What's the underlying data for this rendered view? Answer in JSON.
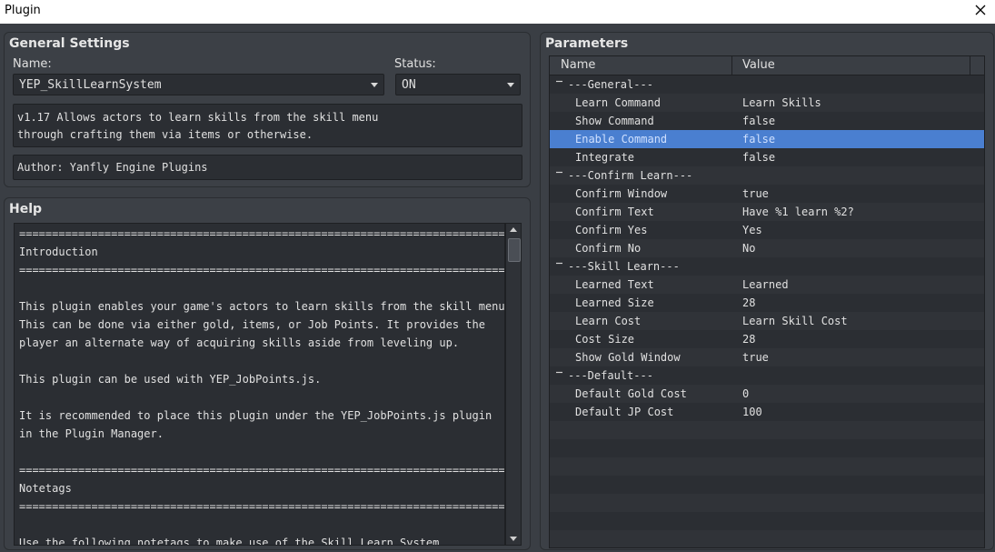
{
  "window": {
    "title": "Plugin"
  },
  "general": {
    "title": "General Settings",
    "name_label": "Name:",
    "name_value": "YEP_SkillLearnSystem",
    "status_label": "Status:",
    "status_value": "ON",
    "description": [
      "v1.17 Allows actors to learn skills from the skill menu",
      "through crafting them via items or otherwise."
    ],
    "author": "Author: Yanfly Engine Plugins"
  },
  "help": {
    "title": "Help",
    "lines": [
      "===========================================================================",
      "Introduction",
      "===========================================================================",
      "",
      "This plugin enables your game's actors to learn skills from the skill menu.",
      "This can be done via either gold, items, or Job Points. It provides the",
      "player an alternate way of acquiring skills aside from leveling up.",
      "",
      "This plugin can be used with YEP_JobPoints.js.",
      "",
      "It is recommended to place this plugin under the YEP_JobPoints.js plugin",
      "in the Plugin Manager.",
      "",
      "===========================================================================",
      "Notetags",
      "===========================================================================",
      "",
      "Use the following notetags to make use of the Skill Learn System."
    ]
  },
  "parameters": {
    "title": "Parameters",
    "col_name": "Name",
    "col_value": "Value",
    "rows": [
      {
        "kind": "group",
        "name": "---General---",
        "value": ""
      },
      {
        "kind": "item",
        "name": "Learn Command",
        "value": "Learn Skills"
      },
      {
        "kind": "item",
        "name": "Show Command",
        "value": "false"
      },
      {
        "kind": "item",
        "name": "Enable Command",
        "value": "false",
        "selected": true
      },
      {
        "kind": "item",
        "name": "Integrate",
        "value": "false"
      },
      {
        "kind": "group",
        "name": "---Confirm Learn---",
        "value": ""
      },
      {
        "kind": "item",
        "name": "Confirm Window",
        "value": "true"
      },
      {
        "kind": "item",
        "name": "Confirm Text",
        "value": "Have %1 learn %2?"
      },
      {
        "kind": "item",
        "name": "Confirm Yes",
        "value": "Yes"
      },
      {
        "kind": "item",
        "name": "Confirm No",
        "value": "No"
      },
      {
        "kind": "group",
        "name": "---Skill Learn---",
        "value": ""
      },
      {
        "kind": "item",
        "name": "Learned Text",
        "value": "Learned"
      },
      {
        "kind": "item",
        "name": "Learned Size",
        "value": "28"
      },
      {
        "kind": "item",
        "name": "Learn Cost",
        "value": "Learn Skill Cost"
      },
      {
        "kind": "item",
        "name": "Cost Size",
        "value": "28"
      },
      {
        "kind": "item",
        "name": "Show Gold Window",
        "value": "true"
      },
      {
        "kind": "group",
        "name": "---Default---",
        "value": ""
      },
      {
        "kind": "item",
        "name": "Default Gold Cost",
        "value": "0"
      },
      {
        "kind": "item",
        "name": "Default JP Cost",
        "value": "100"
      }
    ]
  }
}
